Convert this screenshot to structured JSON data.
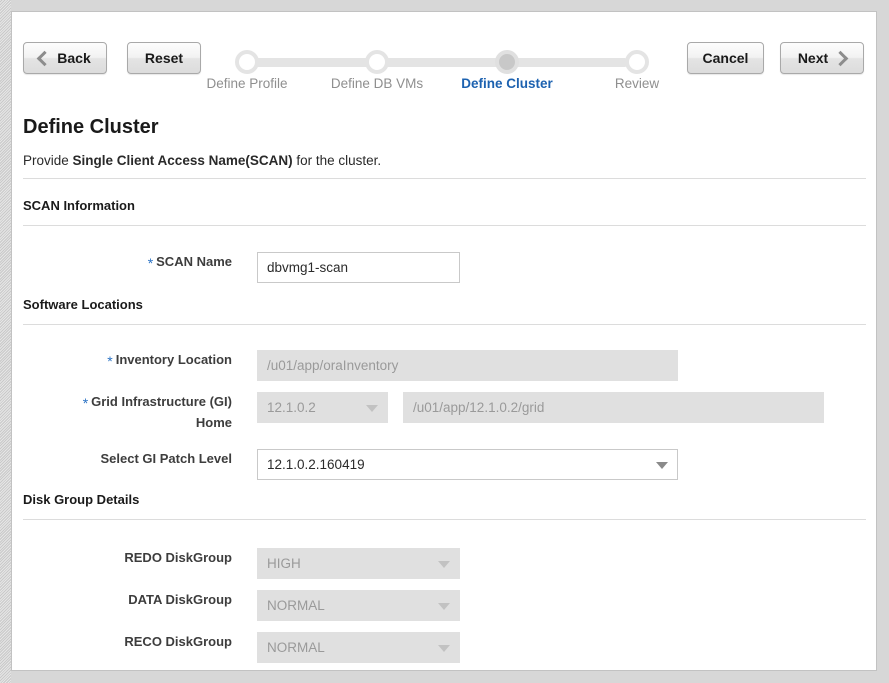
{
  "toolbar": {
    "back_label": "Back",
    "reset_label": "Reset",
    "cancel_label": "Cancel",
    "next_label": "Next"
  },
  "stepper": {
    "steps": [
      {
        "label": "Define Profile",
        "active": false
      },
      {
        "label": "Define DB VMs",
        "active": false
      },
      {
        "label": "Define Cluster",
        "active": true
      },
      {
        "label": "Review",
        "active": false
      }
    ],
    "active_color": "#1d62b0",
    "inactive_color": "#8f8f8f"
  },
  "page": {
    "title": "Define Cluster",
    "subtitle_prefix": "Provide",
    "subtitle_bold": "Single Client Access Name(SCAN)",
    "subtitle_suffix": "for the cluster."
  },
  "sections": {
    "scan": {
      "heading": "SCAN Information",
      "scan_name": {
        "label": "SCAN Name",
        "required": "*",
        "value": "dbvmg1-scan"
      }
    },
    "software": {
      "heading": "Software Locations",
      "inventory_location": {
        "label": "Inventory Location",
        "required": "*",
        "value": "/u01/app/oraInventory"
      },
      "gi_home": {
        "label_line1": "Grid Infrastructure (GI)",
        "label_line2": "Home",
        "required": "*",
        "version": "12.1.0.2",
        "path": "/u01/app/12.1.0.2/grid"
      },
      "gi_patch_level": {
        "label": "Select GI Patch Level",
        "value": "12.1.0.2.160419"
      }
    },
    "diskgroup": {
      "heading": "Disk Group Details",
      "redo": {
        "label": "REDO DiskGroup",
        "value": "HIGH"
      },
      "data": {
        "label": "DATA DiskGroup",
        "value": "NORMAL"
      },
      "reco": {
        "label": "RECO DiskGroup",
        "value": "NORMAL"
      }
    }
  }
}
